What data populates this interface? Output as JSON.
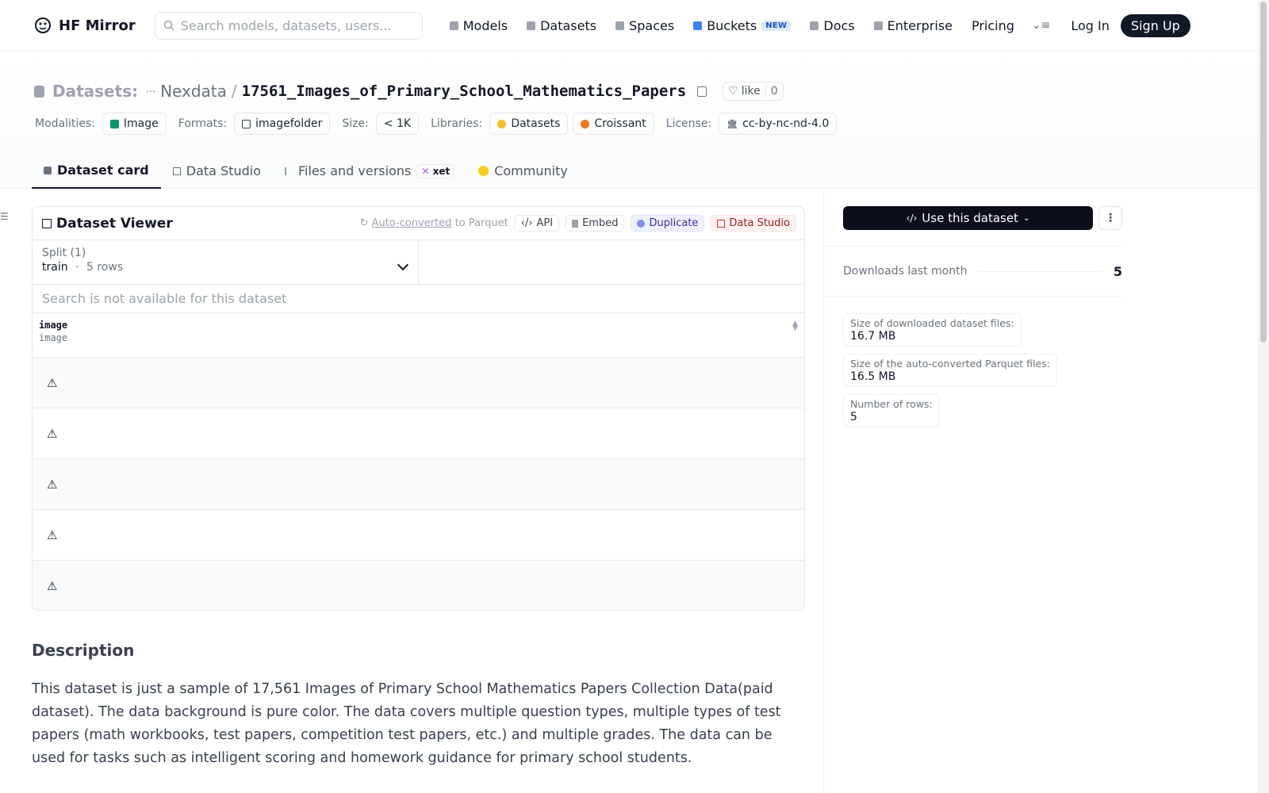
{
  "nav": {
    "brand": "HF Mirror",
    "search_placeholder": "Search models, datasets, users...",
    "links": [
      {
        "label": "Models",
        "icon": "cube-icon",
        "color": "#9ca3af"
      },
      {
        "label": "Datasets",
        "icon": "database-icon",
        "color": "#9ca3af"
      },
      {
        "label": "Spaces",
        "icon": "grid-icon",
        "color": "#9ca3af"
      },
      {
        "label": "Buckets",
        "icon": "bucket-icon",
        "color": "#3b82f6"
      },
      {
        "label": "Docs",
        "icon": "book-icon",
        "color": "#9ca3af"
      },
      {
        "label": "Enterprise",
        "icon": "building-icon",
        "color": "#9ca3af"
      },
      {
        "label": "Pricing"
      }
    ],
    "buckets_badge": "NEW",
    "login": "Log In",
    "signup": "Sign Up"
  },
  "header": {
    "section": "Datasets:",
    "owner": "Nexdata",
    "separator": "/",
    "repo": "17561_Images_of_Primary_School_Mathematics_Papers",
    "like_label": "like",
    "like_count": "0",
    "meta": {
      "modalities_label": "Modalities:",
      "modality": "Image",
      "formats_label": "Formats:",
      "format": "imagefolder",
      "size_label": "Size:",
      "size": "< 1K",
      "libraries_label": "Libraries:",
      "library1": "Datasets",
      "library2": "Croissant",
      "license_label": "License:",
      "license": "cc-by-nc-nd-4.0"
    },
    "tabs": [
      {
        "label": "Dataset card",
        "active": true
      },
      {
        "label": "Data Studio"
      },
      {
        "label": "Files and versions"
      },
      {
        "label": "Community"
      }
    ],
    "xet_label": "xet"
  },
  "viewer": {
    "title": "Dataset Viewer",
    "auto_converted_link": "Auto-converted",
    "auto_converted_rest": " to Parquet",
    "api": "API",
    "embed": "Embed",
    "duplicate": "Duplicate",
    "data_studio": "Data Studio",
    "split_label": "Split (1)",
    "split_name": "train",
    "split_dot": "·",
    "split_rows": "5 rows",
    "search_unavailable": "Search is not available for this dataset",
    "column_name": "image",
    "column_type": "image",
    "rows": [
      "⚠",
      "⚠",
      "⚠",
      "⚠",
      "⚠"
    ]
  },
  "description": {
    "title": "Description",
    "text": "This dataset is just a sample of 17,561 Images of Primary School Mathematics Papers Collection Data(paid dataset). The data background is pure color. The data covers multiple question types, multiple types of test papers (math workbooks, test papers, competition test papers, etc.) and multiple grades. The data can be used for tasks such as intelligent scoring and homework guidance for primary school students."
  },
  "sidebar": {
    "use_button": "Use this dataset",
    "downloads_label": "Downloads last month",
    "downloads_value": "5",
    "stats": [
      {
        "label": "Size of downloaded dataset files:",
        "value": "16.7 MB"
      },
      {
        "label": "Size of the auto-converted Parquet files:",
        "value": "16.5 MB"
      },
      {
        "label": "Number of rows:",
        "value": "5"
      }
    ]
  }
}
